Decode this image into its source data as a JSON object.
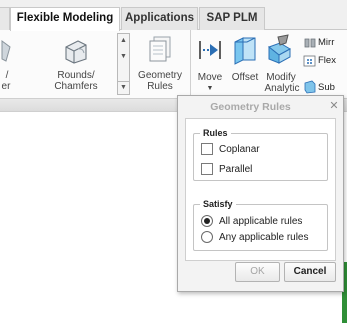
{
  "tabs": [
    {
      "label": "Flexible Modeling",
      "active": true
    },
    {
      "label": "Applications",
      "active": false
    },
    {
      "label": "SAP PLM",
      "active": false
    }
  ],
  "ribbon": {
    "left_fragment_label_1": "/",
    "left_fragment_label_2": "er",
    "rounds_chamfers": {
      "line1": "Rounds/",
      "line2": "Chamfers",
      "icon": "rounds-chamfers-icon"
    },
    "geometry_rules": {
      "line1": "Geometry",
      "line2": "Rules",
      "icon": "geometry-rules-icon"
    },
    "move": {
      "label": "Move",
      "icon": "move-icon"
    },
    "offset": {
      "label": "Offset",
      "icon": "offset-icon"
    },
    "modify_analytic": {
      "line1": "Modify",
      "line2": "Analytic",
      "icon": "modify-analytic-icon"
    },
    "mirror_fragment": "Mirr",
    "flex_fragment": "Flex",
    "sub_fragment": "Sub"
  },
  "dialog": {
    "title": "Geometry Rules",
    "close_glyph": "✕",
    "rules_group": {
      "legend": "Rules",
      "items": [
        {
          "label": "Coplanar",
          "checked": false
        },
        {
          "label": "Parallel",
          "checked": false
        }
      ]
    },
    "satisfy_group": {
      "legend": "Satisfy",
      "options": [
        {
          "label": "All applicable rules",
          "selected": true
        },
        {
          "label": "Any applicable rules",
          "selected": false
        }
      ]
    },
    "ok_label": "OK",
    "cancel_label": "Cancel"
  },
  "colors": {
    "accent_blue": "#2b6fb5",
    "green_edge": "#2f8f37",
    "disabled_text": "#a5a5a5"
  }
}
